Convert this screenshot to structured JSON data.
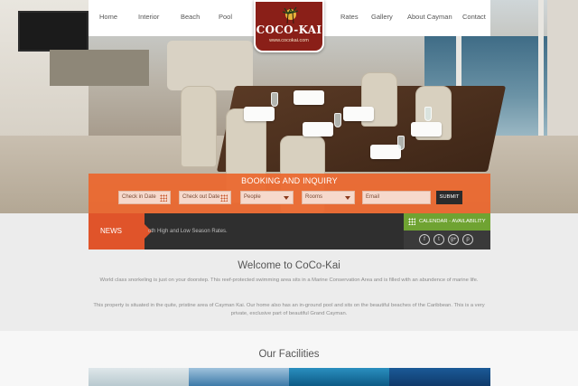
{
  "nav": {
    "left": [
      "Home",
      "Interior",
      "Beach",
      "Pool"
    ],
    "right": [
      "Rates",
      "Gallery",
      "About Cayman",
      "Contact"
    ]
  },
  "logo": {
    "name": "COCO-KAI",
    "url": "www.cocokai.com"
  },
  "booking": {
    "title": "BOOKING AND INQUIRY",
    "check_in": "Check in Date",
    "check_out": "Check out Date",
    "people": "People",
    "rooms": "Rooms",
    "email": "Email",
    "submit": "SUBMIT"
  },
  "news": {
    "label": "NEWS",
    "text": "oth High and Low Season Rates.",
    "calendar": "CALENDAR - AVAILABILITY",
    "socials": [
      "f",
      "t",
      "g+",
      "p"
    ]
  },
  "welcome": {
    "title": "Welcome to CoCo-Kai",
    "para1": "World class snorkeling is just on your doorstep. This reef-protected swimming area sits in a Marine Conservation Area and is filled with an abundence of marine life.",
    "para2": "This property is situated in the quite, pristine area of Cayman Kai. Our home also has an in-ground pool and sits on the beautiful beaches of the Caribbean. This is a very private, exclusive part of beautiful Grand Cayman."
  },
  "facilities": {
    "title": "Our Facilities"
  },
  "colors": {
    "orange": "#ec662c",
    "green": "#6fa332",
    "logo": "#8a1f18",
    "dark": "#2f2f2f"
  }
}
